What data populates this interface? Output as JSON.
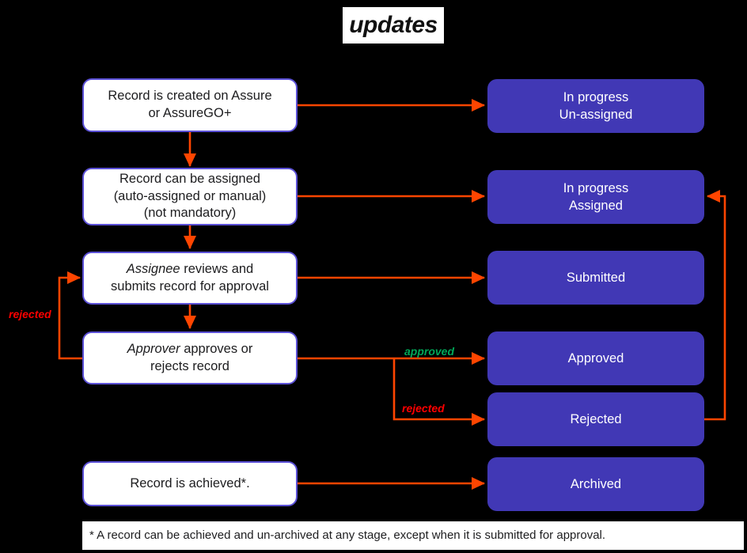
{
  "title": {
    "text": "updates"
  },
  "colors": {
    "background": "#000000",
    "status_fill": "#4138b5",
    "status_text": "#ffffff",
    "process_border": "#5b50d6",
    "process_fill": "#ffffff",
    "connector": "#ff4500",
    "approved_label": "#00a758",
    "rejected_label": "#ff0000"
  },
  "process_steps": [
    {
      "id": "record-created",
      "line1": "Record is created on Assure",
      "line2": "or AssureGO+"
    },
    {
      "id": "record-assigned",
      "line1": "Record can be assigned",
      "line2": "(auto-assigned or manual)",
      "line3": "(not mandatory)"
    },
    {
      "id": "assignee-reviews",
      "emphasis": "Assignee",
      "line1_rest": " reviews and",
      "line2": "submits record for approval"
    },
    {
      "id": "approver-decides",
      "emphasis": "Approver",
      "line1_rest": " approves or",
      "line2": "rejects record"
    },
    {
      "id": "record-archived",
      "line1": "Record is achieved*."
    }
  ],
  "statuses": [
    {
      "id": "in-progress-unassigned",
      "line1": "In progress",
      "line2": "Un-assigned"
    },
    {
      "id": "in-progress-assigned",
      "line1": "In progress",
      "line2": "Assigned"
    },
    {
      "id": "submitted",
      "line1": "Submitted"
    },
    {
      "id": "approved",
      "line1": "Approved"
    },
    {
      "id": "rejected",
      "line1": "Rejected"
    },
    {
      "id": "archived",
      "line1": "Archived"
    }
  ],
  "edge_labels": {
    "approved": "approved",
    "rejected_branch": "rejected",
    "rejected_loop": "rejected"
  },
  "footnote": {
    "text": "* A record can be achieved and un-archived at any stage, except when it is submitted for approval."
  }
}
